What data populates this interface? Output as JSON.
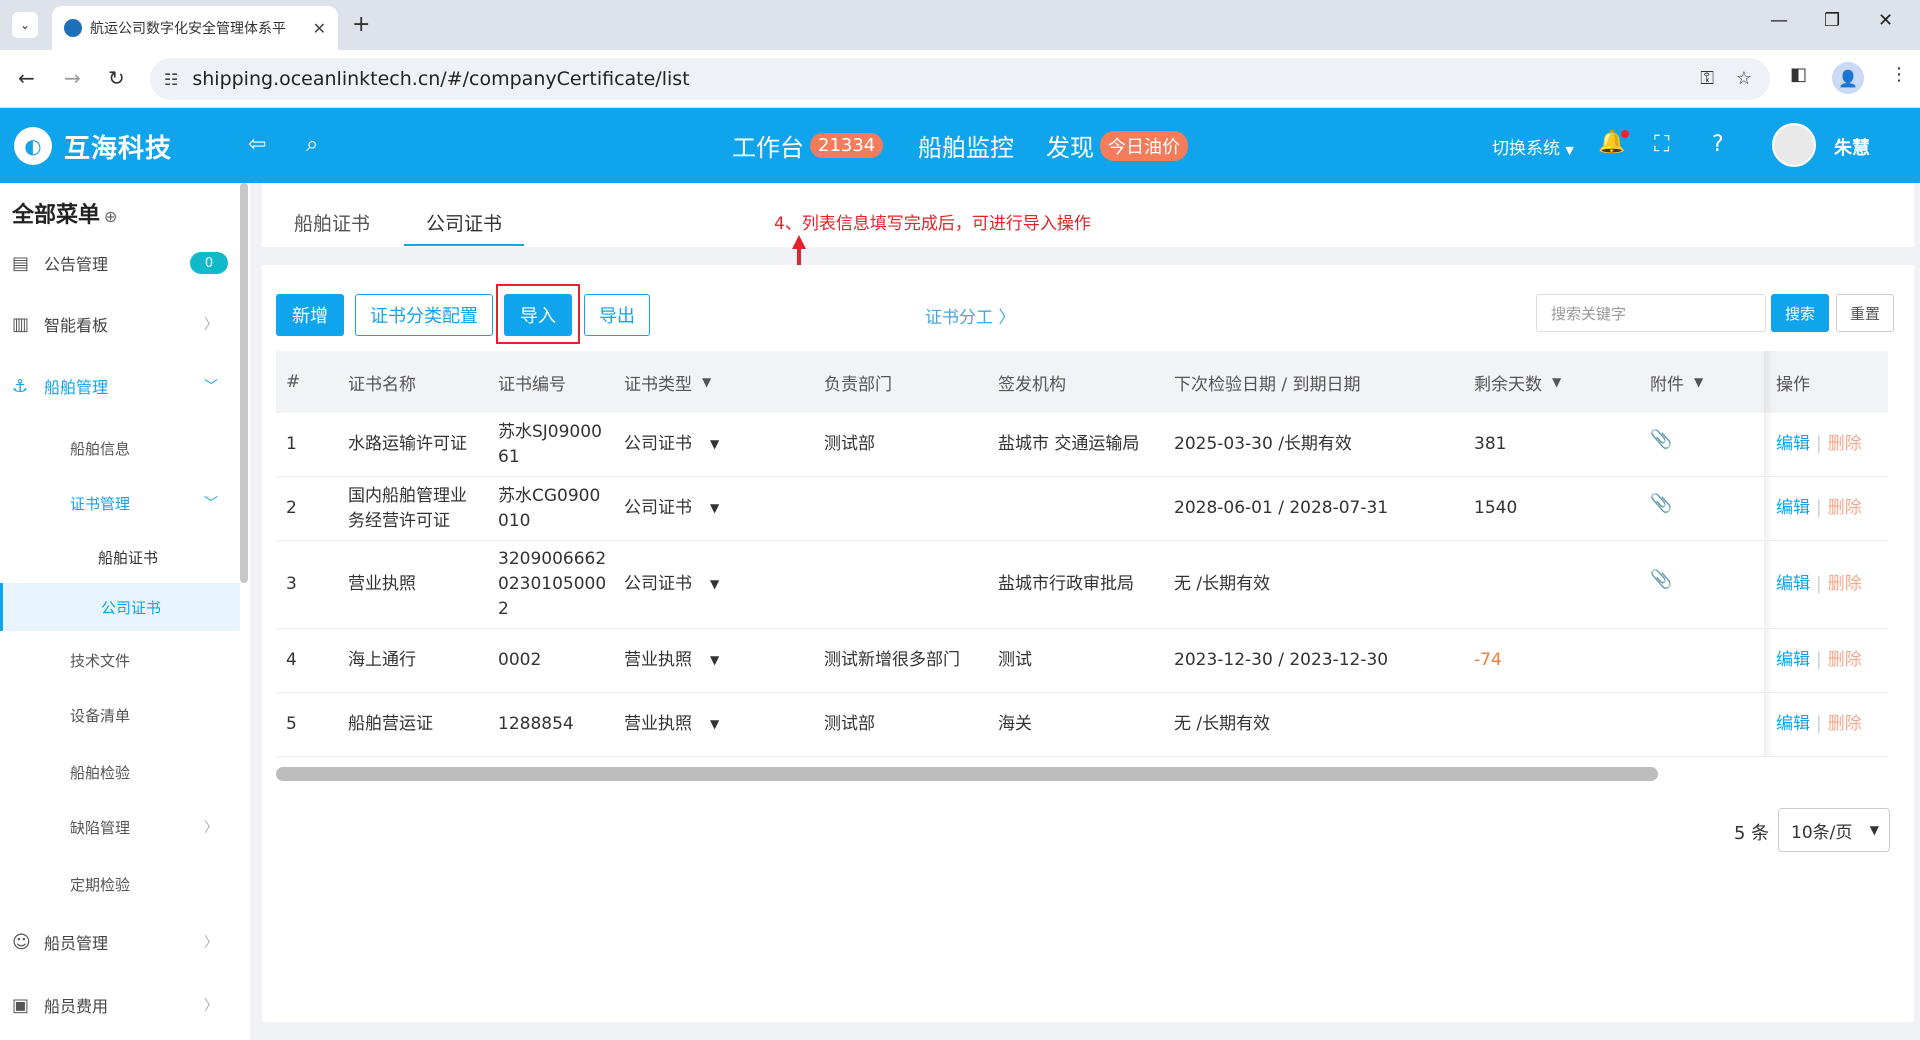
{
  "browser": {
    "tab_title": "航运公司数字化安全管理体系平",
    "url": "shipping.oceanlinktech.cn/#/companyCertificate/list",
    "new_tab": "+",
    "close_tab": "✕",
    "win_min": "—",
    "win_max": "❐",
    "win_close": "✕"
  },
  "header": {
    "logo_text": "互海科技",
    "nav": [
      {
        "label": "工作台",
        "badge": "21334"
      },
      {
        "label": "船舶监控"
      },
      {
        "label": "发现",
        "badge": "今日油价"
      }
    ],
    "switch_system": "切换系统",
    "user_name": "朱慧"
  },
  "sidebar": {
    "title": "全部菜单",
    "items": [
      {
        "label": "公告管理",
        "badge": "0"
      },
      {
        "label": "智能看板"
      },
      {
        "label": "船舶管理"
      },
      {
        "label": "船舶信息"
      },
      {
        "label": "证书管理"
      },
      {
        "label": "船舶证书"
      },
      {
        "label": "公司证书"
      },
      {
        "label": "技术文件"
      },
      {
        "label": "设备清单"
      },
      {
        "label": "船舶检验"
      },
      {
        "label": "缺陷管理"
      },
      {
        "label": "定期检验"
      },
      {
        "label": "船员管理"
      },
      {
        "label": "船员费用"
      }
    ]
  },
  "tabs": {
    "ship_cert": "船舶证书",
    "company_cert": "公司证书",
    "annotation": "4、列表信息填写完成后，可进行导入操作"
  },
  "toolbar": {
    "add": "新增",
    "category_config": "证书分类配置",
    "import": "导入",
    "export": "导出",
    "assign": "证书分工 〉",
    "search_placeholder": "搜索关键字",
    "search": "搜索",
    "reset": "重置"
  },
  "table": {
    "headers": {
      "index": "#",
      "name": "证书名称",
      "number": "证书编号",
      "type": "证书类型",
      "dept": "负责部门",
      "issuer": "签发机构",
      "dates": "下次检验日期 / 到期日期",
      "days": "剩余天数",
      "attach": "附件",
      "ops": "操作"
    },
    "edit": "编辑",
    "delete": "删除",
    "rows": [
      {
        "index": "1",
        "name": "水路运输许可证",
        "number": "苏水SJ09000\n61",
        "type": "公司证书",
        "dept": "测试部",
        "issuer": "盐城市 交通运输局",
        "dates": "2025-03-30 /长期有效",
        "days": "381",
        "attach": true
      },
      {
        "index": "2",
        "name": "国内船舶管理业\n务经营许可证",
        "number": "苏水CG0900\n010",
        "type": "公司证书",
        "dept": "",
        "issuer": "",
        "dates": "2028-06-01 / 2028-07-31",
        "days": "1540",
        "attach": true
      },
      {
        "index": "3",
        "name": "营业执照",
        "number": "3209006662\n0230105000\n2",
        "type": "公司证书",
        "dept": "",
        "issuer": "盐城市行政审批局",
        "dates": "无 /长期有效",
        "days": "",
        "attach": true
      },
      {
        "index": "4",
        "name": "海上通行",
        "number": "0002",
        "type": "营业执照",
        "dept": "测试新增很多部门",
        "issuer": "测试",
        "dates": "2023-12-30 / 2023-12-30",
        "days": "-74",
        "attach": false
      },
      {
        "index": "5",
        "name": "船舶营运证",
        "number": "1288854",
        "type": "营业执照",
        "dept": "测试部",
        "issuer": "海关",
        "dates": "无 /长期有效",
        "days": "",
        "attach": false
      }
    ]
  },
  "pagination": {
    "count": "5 条",
    "page_size": "10条/页"
  },
  "colors": {
    "brand": "#0fa4ec",
    "annotation": "#e5232d",
    "negative": "#f07c3a",
    "delete": "#f4a88a"
  }
}
